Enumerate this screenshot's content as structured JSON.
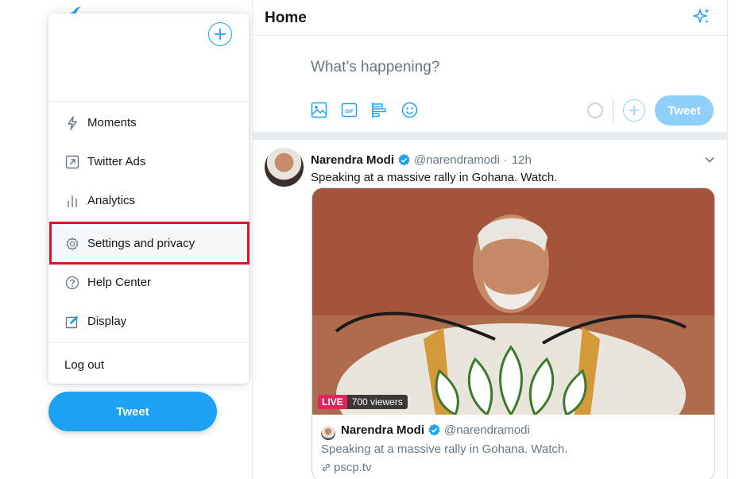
{
  "menu": {
    "items": [
      {
        "label": "Moments",
        "icon": "lightning-icon"
      },
      {
        "label": "Twitter Ads",
        "icon": "external-arrow-icon"
      },
      {
        "label": "Analytics",
        "icon": "bar-chart-icon"
      },
      {
        "label": "Settings and privacy",
        "icon": "gear-icon"
      },
      {
        "label": "Help Center",
        "icon": "question-circle-icon"
      },
      {
        "label": "Display",
        "icon": "edit-display-icon"
      }
    ],
    "logout_label": "Log out"
  },
  "sidebar": {
    "tweet_button_label": "Tweet"
  },
  "header": {
    "title": "Home"
  },
  "composer": {
    "placeholder": "What’s happening?",
    "tweet_button_label": "Tweet"
  },
  "tweet": {
    "name": "Narendra Modi",
    "handle": "@narendramodi",
    "time": "12h",
    "text": "Speaking at a massive rally in Gohana. Watch.",
    "live_label": "LIVE",
    "viewers": "700 viewers",
    "card": {
      "name": "Narendra Modi",
      "handle": "@narendramodi",
      "text": "Speaking at a massive rally in Gohana. Watch.",
      "link": "pscp.tv"
    }
  },
  "colors": {
    "accent": "#1da1f2",
    "accent_disabled": "#8ed0f9",
    "highlight": "#e0112a",
    "live": "#e0245e"
  }
}
